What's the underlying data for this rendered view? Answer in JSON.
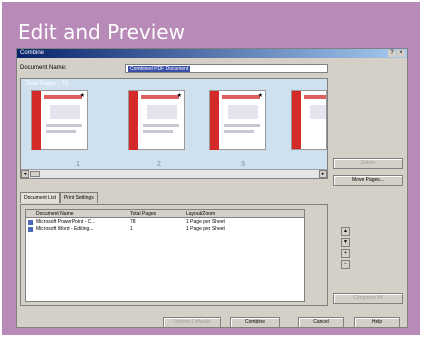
{
  "slide_title": "Edit and Preview",
  "window": {
    "title": "Combine",
    "controls": [
      "?",
      "×"
    ]
  },
  "document_name": {
    "label": "Document Name:",
    "value": "Combined PDF Document"
  },
  "preview": {
    "header": "Total Pages : 79",
    "pages": [
      {
        "number": "1",
        "badge": "★"
      },
      {
        "number": "2",
        "badge": "★"
      },
      {
        "number": "3",
        "badge": "★"
      }
    ]
  },
  "buttons": {
    "delete": "Delete",
    "move_pages": "Move Pages...",
    "compress": "Compress All",
    "options": "Options Defaults",
    "combine": "Combine",
    "cancel": "Cancel",
    "help": "Help"
  },
  "tabs": [
    "Document List",
    "Print Settings"
  ],
  "list": {
    "columns": [
      "Document Name",
      "Total Pages",
      "Layout/Zoom"
    ],
    "rows": [
      {
        "name": "Microsoft PowerPoint - C...",
        "pages": "78",
        "layout": "1 Page per Sheet"
      },
      {
        "name": "Microsoft Word - Editing...",
        "pages": "1",
        "layout": "1 Page per Sheet"
      }
    ]
  },
  "side_controls": [
    "▲",
    "▼",
    "+",
    "−"
  ]
}
